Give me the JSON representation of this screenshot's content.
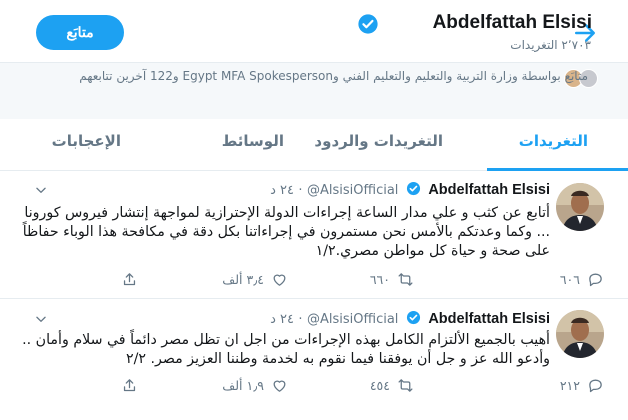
{
  "header": {
    "name": "Abdelfattah Elsisi",
    "tweet_count": "٢٬٧٠٣ التغريدات",
    "follow_button": "متابَع",
    "accent": "#1da1f2"
  },
  "followed_by": {
    "text": "متابَع بواسطة وزارة التربية والتعليم والتعليم الفني وEgypt MFA Spokesperson و122 آخرين تتابعهم"
  },
  "tabs": [
    {
      "label": "التغريدات",
      "active": true
    },
    {
      "label": "التغريدات والردود",
      "active": false
    },
    {
      "label": "الوسائط",
      "active": false
    },
    {
      "label": "الإعجابات",
      "active": false
    }
  ],
  "tweets": [
    {
      "name": "Abdelfattah Elsisi",
      "handle": "@AlsisiOfficial",
      "dot": "·",
      "time": "٢٤ د",
      "body": "أتابع عن كثب و علي مدار الساعة إجراءات الدولة الإحترازية لمواجهة إنتشار فيروس كورونا ... وكما وعدتكم بالأمس نحن مستمرون في إجراءاتنا بكل دقة في مكافحة هذا الوباء حفاظاً على صحة و حياة كل مواطن مصري.١/٢",
      "replies": "٦٠٦",
      "retweets": "٦٦٠",
      "likes": "٣٫٤ ألف"
    },
    {
      "name": "Abdelfattah Elsisi",
      "handle": "@AlsisiOfficial",
      "dot": "·",
      "time": "٢٤ د",
      "body": "أهيب بالجميع الألتزام الكامل بهذه الإجراءات من اجل ان تظل مصر دائماً في سلام وأمان .. وأدعو الله عز و جل أن يوفقنا فيما نقوم به لخدمة وطننا العزيز مصر. ٢/٢",
      "replies": "٢١٢",
      "retweets": "٤٥٤",
      "likes": "١٫٩ ألف"
    }
  ]
}
